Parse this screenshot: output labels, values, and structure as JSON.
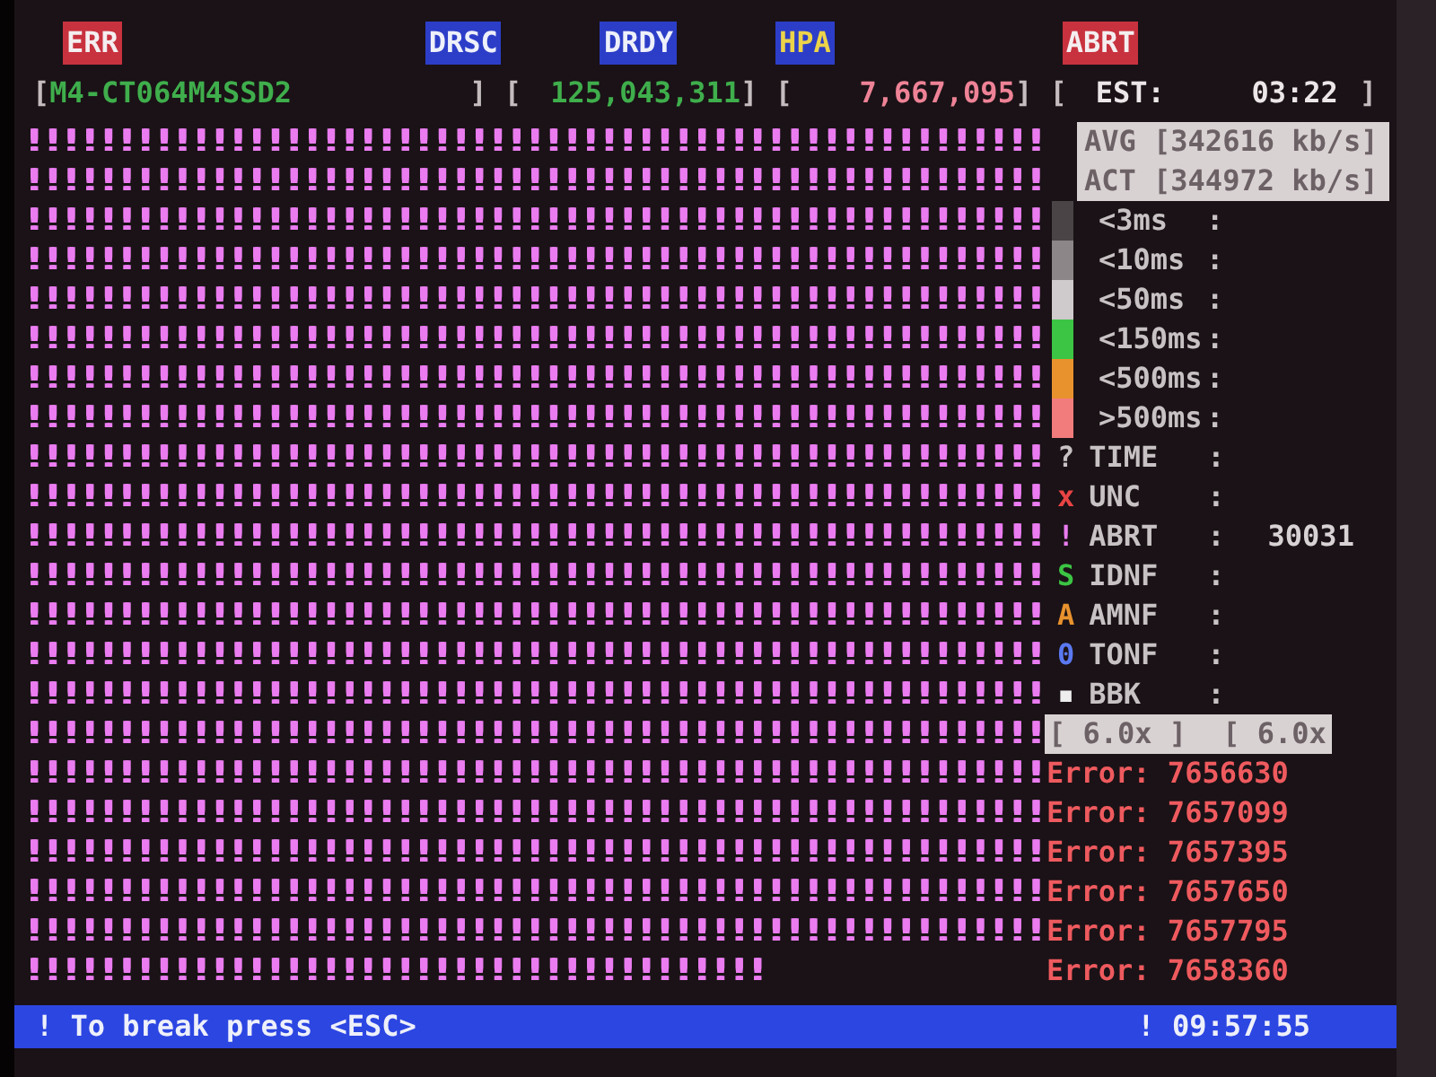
{
  "status_flags": [
    {
      "text": "ERR",
      "kind": "error"
    },
    {
      "text": "DRSC",
      "kind": "status"
    },
    {
      "text": "DRDY",
      "kind": "status"
    },
    {
      "text": "HPA",
      "kind": "hpa"
    },
    {
      "text": "ABRT",
      "kind": "error"
    }
  ],
  "drive_line": [
    {
      "kind": "bracket",
      "text": "["
    },
    {
      "kind": "model",
      "text": "M4-CT064M4SSD2"
    },
    {
      "kind": "bracket",
      "text": "] ["
    },
    {
      "kind": "total",
      "text": "125,043,311"
    },
    {
      "kind": "bracket",
      "text": "] ["
    },
    {
      "kind": "position",
      "text": "7,667,095"
    },
    {
      "kind": "bracket",
      "text": "] ["
    },
    {
      "kind": "label",
      "text": "EST:"
    },
    {
      "kind": "time",
      "text": "03:22"
    },
    {
      "kind": "bracket",
      "text": "]"
    }
  ],
  "block_map": {
    "rows": [
      "!!!!!!!!!!!!!!!!!!!!!!!!!!!!!!!!!!!!!!!!!!!!!!!!!!!!!!!",
      "!!!!!!!!!!!!!!!!!!!!!!!!!!!!!!!!!!!!!!!!!!!!!!!!!!!!!!!",
      "!!!!!!!!!!!!!!!!!!!!!!!!!!!!!!!!!!!!!!!!!!!!!!!!!!!!!!!",
      "!!!!!!!!!!!!!!!!!!!!!!!!!!!!!!!!!!!!!!!!!!!!!!!!!!!!!!!",
      "!!!!!!!!!!!!!!!!!!!!!!!!!!!!!!!!!!!!!!!!!!!!!!!!!!!!!!!",
      "!!!!!!!!!!!!!!!!!!!!!!!!!!!!!!!!!!!!!!!!!!!!!!!!!!!!!!!",
      "!!!!!!!!!!!!!!!!!!!!!!!!!!!!!!!!!!!!!!!!!!!!!!!!!!!!!!!",
      "!!!!!!!!!!!!!!!!!!!!!!!!!!!!!!!!!!!!!!!!!!!!!!!!!!!!!!!",
      "!!!!!!!!!!!!!!!!!!!!!!!!!!!!!!!!!!!!!!!!!!!!!!!!!!!!!!!",
      "!!!!!!!!!!!!!!!!!!!!!!!!!!!!!!!!!!!!!!!!!!!!!!!!!!!!!!!",
      "!!!!!!!!!!!!!!!!!!!!!!!!!!!!!!!!!!!!!!!!!!!!!!!!!!!!!!!",
      "!!!!!!!!!!!!!!!!!!!!!!!!!!!!!!!!!!!!!!!!!!!!!!!!!!!!!!!",
      "!!!!!!!!!!!!!!!!!!!!!!!!!!!!!!!!!!!!!!!!!!!!!!!!!!!!!!!",
      "!!!!!!!!!!!!!!!!!!!!!!!!!!!!!!!!!!!!!!!!!!!!!!!!!!!!!!!",
      "!!!!!!!!!!!!!!!!!!!!!!!!!!!!!!!!!!!!!!!!!!!!!!!!!!!!!!!",
      "!!!!!!!!!!!!!!!!!!!!!!!!!!!!!!!!!!!!!!!!!!!!!!!!!!!!!!!",
      "!!!!!!!!!!!!!!!!!!!!!!!!!!!!!!!!!!!!!!!!!!!!!!!!!!!!!!!",
      "!!!!!!!!!!!!!!!!!!!!!!!!!!!!!!!!!!!!!!!!!!!!!!!!!!!!!!!",
      "!!!!!!!!!!!!!!!!!!!!!!!!!!!!!!!!!!!!!!!!!!!!!!!!!!!!!!!",
      "!!!!!!!!!!!!!!!!!!!!!!!!!!!!!!!!!!!!!!!!!!!!!!!!!!!!!!!",
      "!!!!!!!!!!!!!!!!!!!!!!!!!!!!!!!!!!!!!!!!!!!!!!!!!!!!!!!",
      "!!!!!!!!!!!!!!!!!!!!!!!!!!!!!!!!!!!!!!!!"
    ]
  },
  "speed": {
    "avg": "AVG [342616 kb/s]",
    "act": "ACT [344972 kb/s]"
  },
  "timings": [
    {
      "label": "<3ms",
      "separator": ":",
      "color": "#4a4446"
    },
    {
      "label": "<10ms",
      "separator": ":",
      "color": "#8c8688"
    },
    {
      "label": "<50ms",
      "separator": ":",
      "color": "#cfcacb"
    },
    {
      "label": "<150ms",
      "separator": ":",
      "color": "#3cc444"
    },
    {
      "label": "<500ms",
      "separator": ":",
      "color": "#e8922e"
    },
    {
      "label": ">500ms",
      "separator": ":",
      "color": "#f27c7c"
    }
  ],
  "error_types": [
    {
      "symbol": "?",
      "label": "TIME",
      "separator": ":",
      "color": "#c8c2c4"
    },
    {
      "symbol": "x",
      "label": "UNC",
      "separator": ":",
      "color": "#e84444"
    },
    {
      "symbol": "!",
      "label": "ABRT",
      "separator": ":",
      "count": "30031",
      "color": "#ea7cf0"
    },
    {
      "symbol": "S",
      "label": "IDNF",
      "separator": ":",
      "color": "#3cc444"
    },
    {
      "symbol": "A",
      "label": "AMNF",
      "separator": ":",
      "color": "#e8922e"
    },
    {
      "symbol": "0",
      "label": "TONF",
      "separator": ":",
      "color": "#5a78f0"
    },
    {
      "symbol": "▪",
      "label": "BBK",
      "separator": ":",
      "color": "#eeeeee"
    }
  ],
  "scale_box": [
    "[ 6.0x ]",
    "[ 6.0x"
  ],
  "error_log": [
    "Error: 7656630",
    "Error: 7657099",
    "Error: 7657395",
    "Error: 7657650",
    "Error: 7657795",
    "Error: 7658360"
  ],
  "status_bar": {
    "message": "! To break press <ESC>",
    "clock": "! 09:57:55"
  }
}
